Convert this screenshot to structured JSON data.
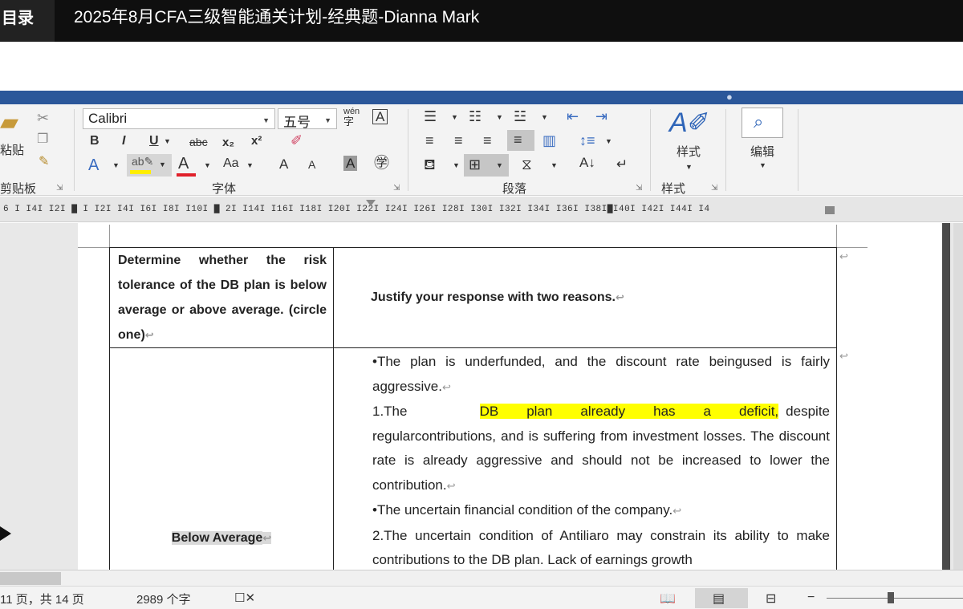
{
  "player": {
    "toc_label": "目录",
    "video_title": "2025年8月CFA三级智能通关计划-经典题-Dianna Mark"
  },
  "ribbon": {
    "clipboard": {
      "paste_label": "粘贴",
      "group_label": "剪贴板"
    },
    "font": {
      "font_name": "Calibri",
      "font_size": "五号",
      "bold": "B",
      "italic": "I",
      "underline": "U",
      "strike": "abc",
      "subscript": "x₂",
      "superscript": "x²",
      "change_case": "Aa",
      "grow": "A",
      "shrink": "A",
      "char_shading": "A",
      "pinyin": "wén",
      "enclosed": "字",
      "group_label": "字体"
    },
    "paragraph": {
      "group_label": "段落"
    },
    "styles": {
      "label": "样式",
      "group_label": "样式"
    },
    "editing": {
      "label": "编辑"
    }
  },
  "ruler": {
    "ticks": "6 I  I4I  I2I  ▇  I  I2I  I4I  I6I  I8I  I10I ▇ 2I  I14I  I16I  I18I  I20I  I22I  I24I  I26I  I28I  I30I  I32I  I34I  I36I  I38I▇I40I  I42I  I44I  I4"
  },
  "document": {
    "header_left": "Determine whether the risk tolerance of the DB plan is below average or above average. (circle one)",
    "header_right": "Justify your response with two reasons.",
    "answer_left": "Below Average",
    "bullet1": "•The plan is underfunded, and the discount rate beingused is fairly aggressive.",
    "reason1_prefix": "1.The",
    "reason1_highlight": "DB plan already has a deficit,",
    "reason1_rest_first": "despite",
    "reason1_rest": "regularcontributions, and is suffering from investment losses. The discount rate is already aggressive and should not be increased to lower the contribution.",
    "bullet2": "•The uncertain financial condition of the company.",
    "reason2": "2.The uncertain condition of Antiliaro may constrain its ability to make contributions to the DB plan. Lack of earnings growth"
  },
  "status": {
    "page_info": "11 页，共 14 页",
    "word_count": "2989 个字"
  }
}
